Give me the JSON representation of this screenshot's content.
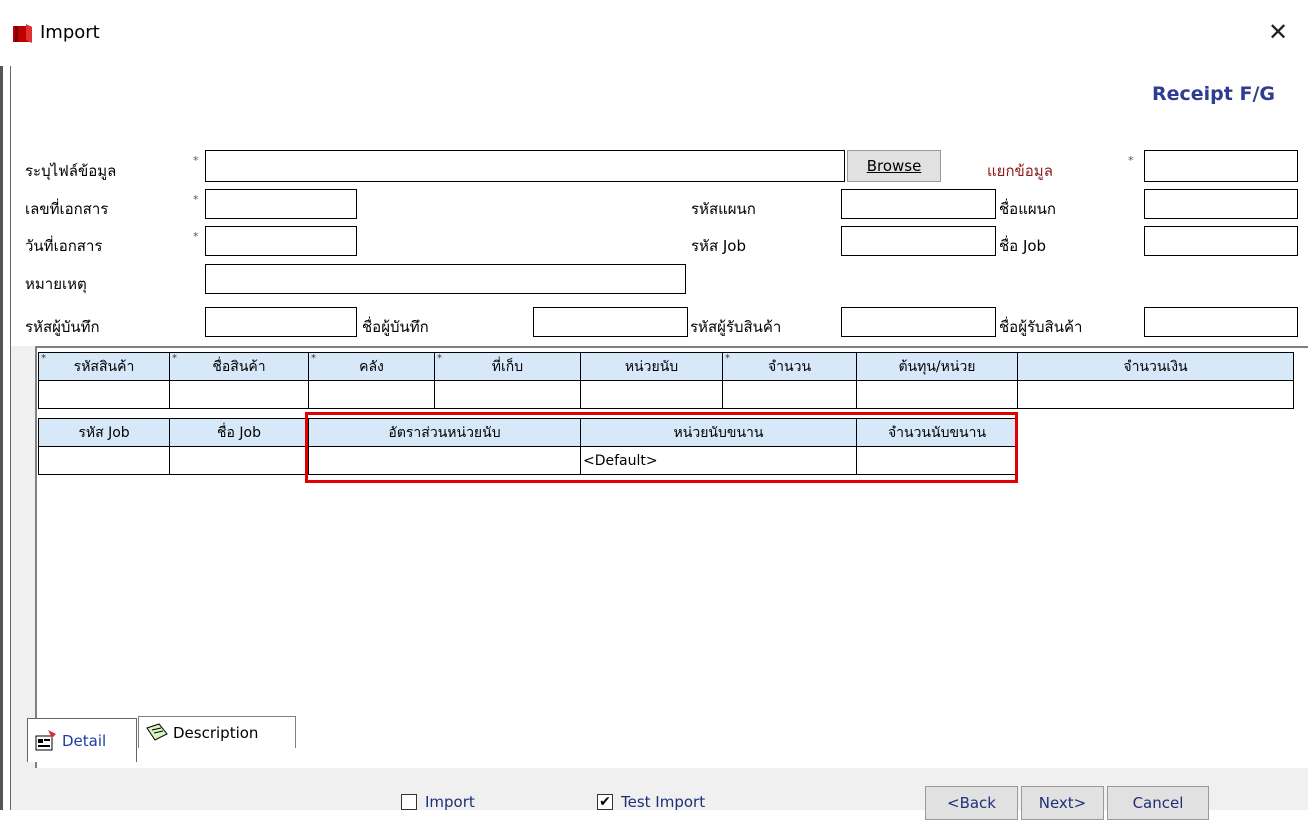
{
  "window": {
    "title": "Import",
    "close_glyph": "✕"
  },
  "header": {
    "module_title": "Receipt F/G"
  },
  "form": {
    "file_label": "ระบุไฟล์ข้อมูล",
    "file_value": "",
    "browse_label": "Browse",
    "separator_label": "แยกข้อมูล",
    "doc_no_label": "เลขที่เอกสาร",
    "doc_date_label": "วันที่เอกสาร",
    "remark_label": "หมายเหตุ",
    "recorder_code_label": "รหัสผู้บันทึก",
    "recorder_name_label": "ชื่อผู้บันทึก",
    "dept_code_label": "รหัสแผนก",
    "dept_name_label": "ชื่อแผนก",
    "job_code_label": "รหัส Job",
    "job_name_label": "ชื่อ Job",
    "receiver_code_label": "รหัสผู้รับสินค้า",
    "receiver_name_label": "ชื่อผู้รับสินค้า",
    "required_mark": "*"
  },
  "grid": {
    "row1_headers": [
      "รหัสสินค้า",
      "ชื่อสินค้า",
      "คลัง",
      "ที่เก็บ",
      "หน่วยนับ",
      "จำนวน",
      "ต้นทุน/หน่วย",
      "จำนวนเงิน"
    ],
    "row2_headers": [
      "รหัส Job",
      "ชื่อ Job",
      "อัตราส่วนหน่วยนับ",
      "หน่วยนับขนาน",
      "จำนวนนับขนาน"
    ],
    "parallel_unit_value": "<Default>"
  },
  "tabs": [
    {
      "label": "Detail",
      "active": true
    },
    {
      "label": "Description",
      "active": false
    }
  ],
  "footer": {
    "import_label": "Import",
    "import_checked": false,
    "test_import_label": "Test Import",
    "test_import_checked": true,
    "back_label": "<Back",
    "next_label": "Next>",
    "cancel_label": "Cancel"
  },
  "colors": {
    "highlight": "#e00000",
    "header_bg": "#d7e9f9",
    "module_title": "#2e3d8f",
    "separator_label": "#8b1a1a"
  }
}
